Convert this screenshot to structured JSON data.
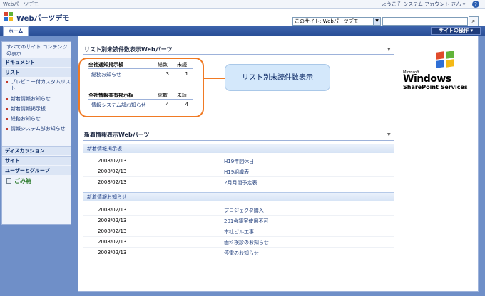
{
  "topbar": {
    "site_name": "Webパーツデモ",
    "welcome": "ようこそ システム アカウント さん ▾",
    "help": "?"
  },
  "header": {
    "title": "Webパーツデモ",
    "scope_value": "このサイト: Webパーツデモ",
    "search_icon": "search-icon"
  },
  "navbar": {
    "home_tab": "ホーム",
    "site_actions": "サイトの操作 ▾"
  },
  "quicklaunch": {
    "view_all": "すべてのサイト コンテンツの表示",
    "documents": "ドキュメント",
    "lists": "リスト",
    "list_items": [
      "プレビュー付カスタムリスト",
      "新着情報お知らせ",
      "新着情報掲示板",
      "総務お知らせ",
      "情報システム部お知らせ"
    ],
    "discussions": "ディスカッション",
    "sites": "サイト",
    "people": "ユーザーとグループ",
    "recycle": "ごみ箱"
  },
  "unread_part": {
    "title": "リスト別未読件数表示Webパーツ",
    "sections": [
      {
        "name": "全社通知掲示板",
        "total_label": "総数",
        "unread_label": "未読",
        "items": [
          {
            "name": "総務お知らせ",
            "total": "3",
            "unread": "1"
          }
        ]
      },
      {
        "name": "全社情報共有掲示板",
        "total_label": "総数",
        "unread_label": "未読",
        "items": [
          {
            "name": "情報システム部お知らせ",
            "total": "4",
            "unread": "4"
          }
        ]
      }
    ]
  },
  "callout": "リスト別未読件数表示",
  "logo": {
    "small": "Microsoft",
    "windows": "Windows",
    "sharepoint": "SharePoint Services"
  },
  "news_part": {
    "title": "新着情報表示Webパーツ",
    "groups": [
      {
        "name": "新着情報掲示板",
        "rows": [
          {
            "date": "2008/02/13",
            "title": "H19年間休日"
          },
          {
            "date": "2008/02/13",
            "title": "H19組織表"
          },
          {
            "date": "2008/02/13",
            "title": "2月月間予定表"
          }
        ]
      },
      {
        "name": "新着情報お知らせ",
        "rows": [
          {
            "date": "2008/02/13",
            "title": "プロジェクタ購入"
          },
          {
            "date": "2008/02/13",
            "title": "201会議室使用不可"
          },
          {
            "date": "2008/02/13",
            "title": "本社ビル工事"
          },
          {
            "date": "2008/02/13",
            "title": "歯科検診のお知らせ"
          },
          {
            "date": "2008/02/13",
            "title": "停電のお知らせ"
          }
        ]
      }
    ]
  },
  "colors": {
    "accent_orange": "#f07a24",
    "nav_blue": "#2a4f97"
  }
}
